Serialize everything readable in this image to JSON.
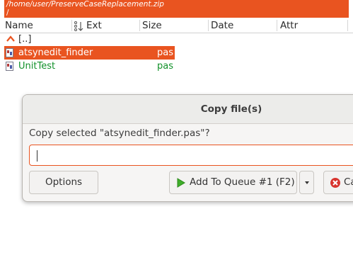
{
  "panel": {
    "path": "/home/user/PreserveCaseReplacement.zip",
    "subpath": "/",
    "columns": {
      "name": "Name",
      "ext": "Ext",
      "size": "Size",
      "date": "Date",
      "attr": "Attr"
    },
    "parent_label": "[..]",
    "files": [
      {
        "name": "atsynedit_finder",
        "ext": "pas",
        "selected": true
      },
      {
        "name": "UnitTest",
        "ext": "pas",
        "selected": false
      }
    ]
  },
  "dialog": {
    "title": "Copy file(s)",
    "prompt": "Copy selected \"atsynedit_finder.pas\"?",
    "input_value": "",
    "options_label": "Options",
    "queue_label": "Add To Queue #1 (F2)",
    "cancel_label": "Cancel"
  },
  "colors": {
    "accent": "#e95420",
    "green_file": "#12912a"
  },
  "icons": [
    "sort-icon",
    "up-arrow-icon",
    "file-icon",
    "play-icon",
    "cancel-icon",
    "chevron-down-icon"
  ]
}
